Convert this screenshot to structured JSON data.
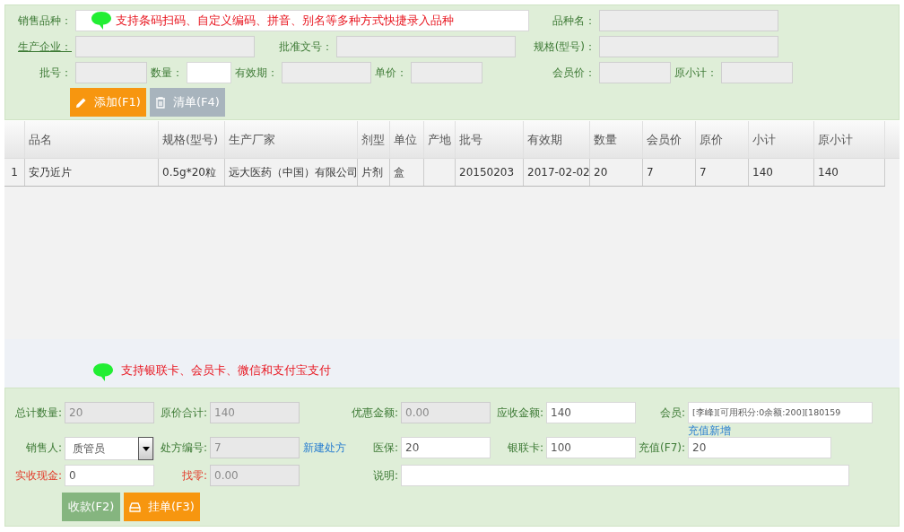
{
  "top_form": {
    "fields": [
      {
        "label": "销售品种：",
        "hint": "支持条码扫码、自定义编码、拼音、别名等多种方式快捷录入品种",
        "disabled": false,
        "underlined": false
      },
      {
        "label": "品种名：",
        "disabled": true,
        "underlined": false
      },
      {
        "label": "生产企业：",
        "underlined": true,
        "disabled": true
      },
      {
        "label": "批准文号：",
        "disabled": true,
        "underlined": false
      },
      {
        "label": "规格(型号)：",
        "disabled": true,
        "underlined": false
      },
      {
        "label": "批号：",
        "disabled": true,
        "underlined": false
      },
      {
        "label": "数量：",
        "disabled": false,
        "underlined": false
      },
      {
        "label": "有效期：",
        "disabled": true,
        "underlined": false
      },
      {
        "label": "单价：",
        "disabled": true,
        "underlined": false
      },
      {
        "label": "会员价：",
        "disabled": true,
        "underlined": false
      },
      {
        "label": "原小计：",
        "disabled": true,
        "underlined": false
      }
    ],
    "buttons": [
      {
        "label": "添加(F1)",
        "kind": "add"
      },
      {
        "label": "清单(F4)",
        "kind": "clear"
      }
    ]
  },
  "table": {
    "columns": [
      "品名",
      "规格(型号)",
      "生产厂家",
      "剂型",
      "单位",
      "产地",
      "批号",
      "有效期",
      "数量",
      "会员价",
      "原价",
      "小计",
      "原小计"
    ],
    "rows": [
      {
        "index": "1",
        "cells": [
          "安乃近片",
          "0.5g*20粒",
          "远大医药（中国）有限公司",
          "片剂",
          "盒",
          "",
          "20150203",
          "2017-02-02",
          "20",
          "7",
          "7",
          "140",
          "140"
        ]
      }
    ]
  },
  "payment_hint": "支持银联卡、会员卡、微信和支付宝支付",
  "payment_form": {
    "rows": [
      [
        {
          "label": "总计数量:",
          "value": "20",
          "disabled": true,
          "emphasis": false
        },
        {
          "label": "原价合计:",
          "value": "140",
          "disabled": true,
          "emphasis": false
        },
        {
          "label": "优惠金额:",
          "value": "0.00",
          "disabled": true,
          "emphasis": false
        },
        {
          "label": "应收金额:",
          "value": "140",
          "disabled": false,
          "emphasis": false
        },
        {
          "label": "会员:",
          "value": "[李峰][可用积分:0余额:200][180159",
          "disabled": false,
          "emphasis": false,
          "below_link": "充值新增"
        }
      ],
      [
        {
          "label": "销售人:",
          "value": "质管员",
          "kind": "select",
          "disabled": false,
          "emphasis": false
        },
        {
          "label": "处方编号:",
          "value": "7",
          "disabled": true,
          "emphasis": false,
          "link": "新建处方"
        },
        {
          "label": "医保:",
          "value": "20",
          "disabled": false,
          "emphasis": false
        },
        {
          "label": "银联卡:",
          "value": "100",
          "disabled": false,
          "emphasis": false
        },
        {
          "label": "充值(F7):",
          "value": "20",
          "disabled": false,
          "emphasis": false
        }
      ],
      [
        {
          "label": "实收现金:",
          "value": "0",
          "emphasis": true,
          "disabled": false
        },
        {
          "label": "找零:",
          "value": "0.00",
          "emphasis": true,
          "disabled": true
        },
        {
          "label": "说明:",
          "disabled": false,
          "emphasis": false
        }
      ]
    ],
    "buttons": [
      {
        "label": "收款(F2)",
        "kind": "collect"
      },
      {
        "label": "挂单(F3)",
        "kind": "hold"
      }
    ]
  }
}
